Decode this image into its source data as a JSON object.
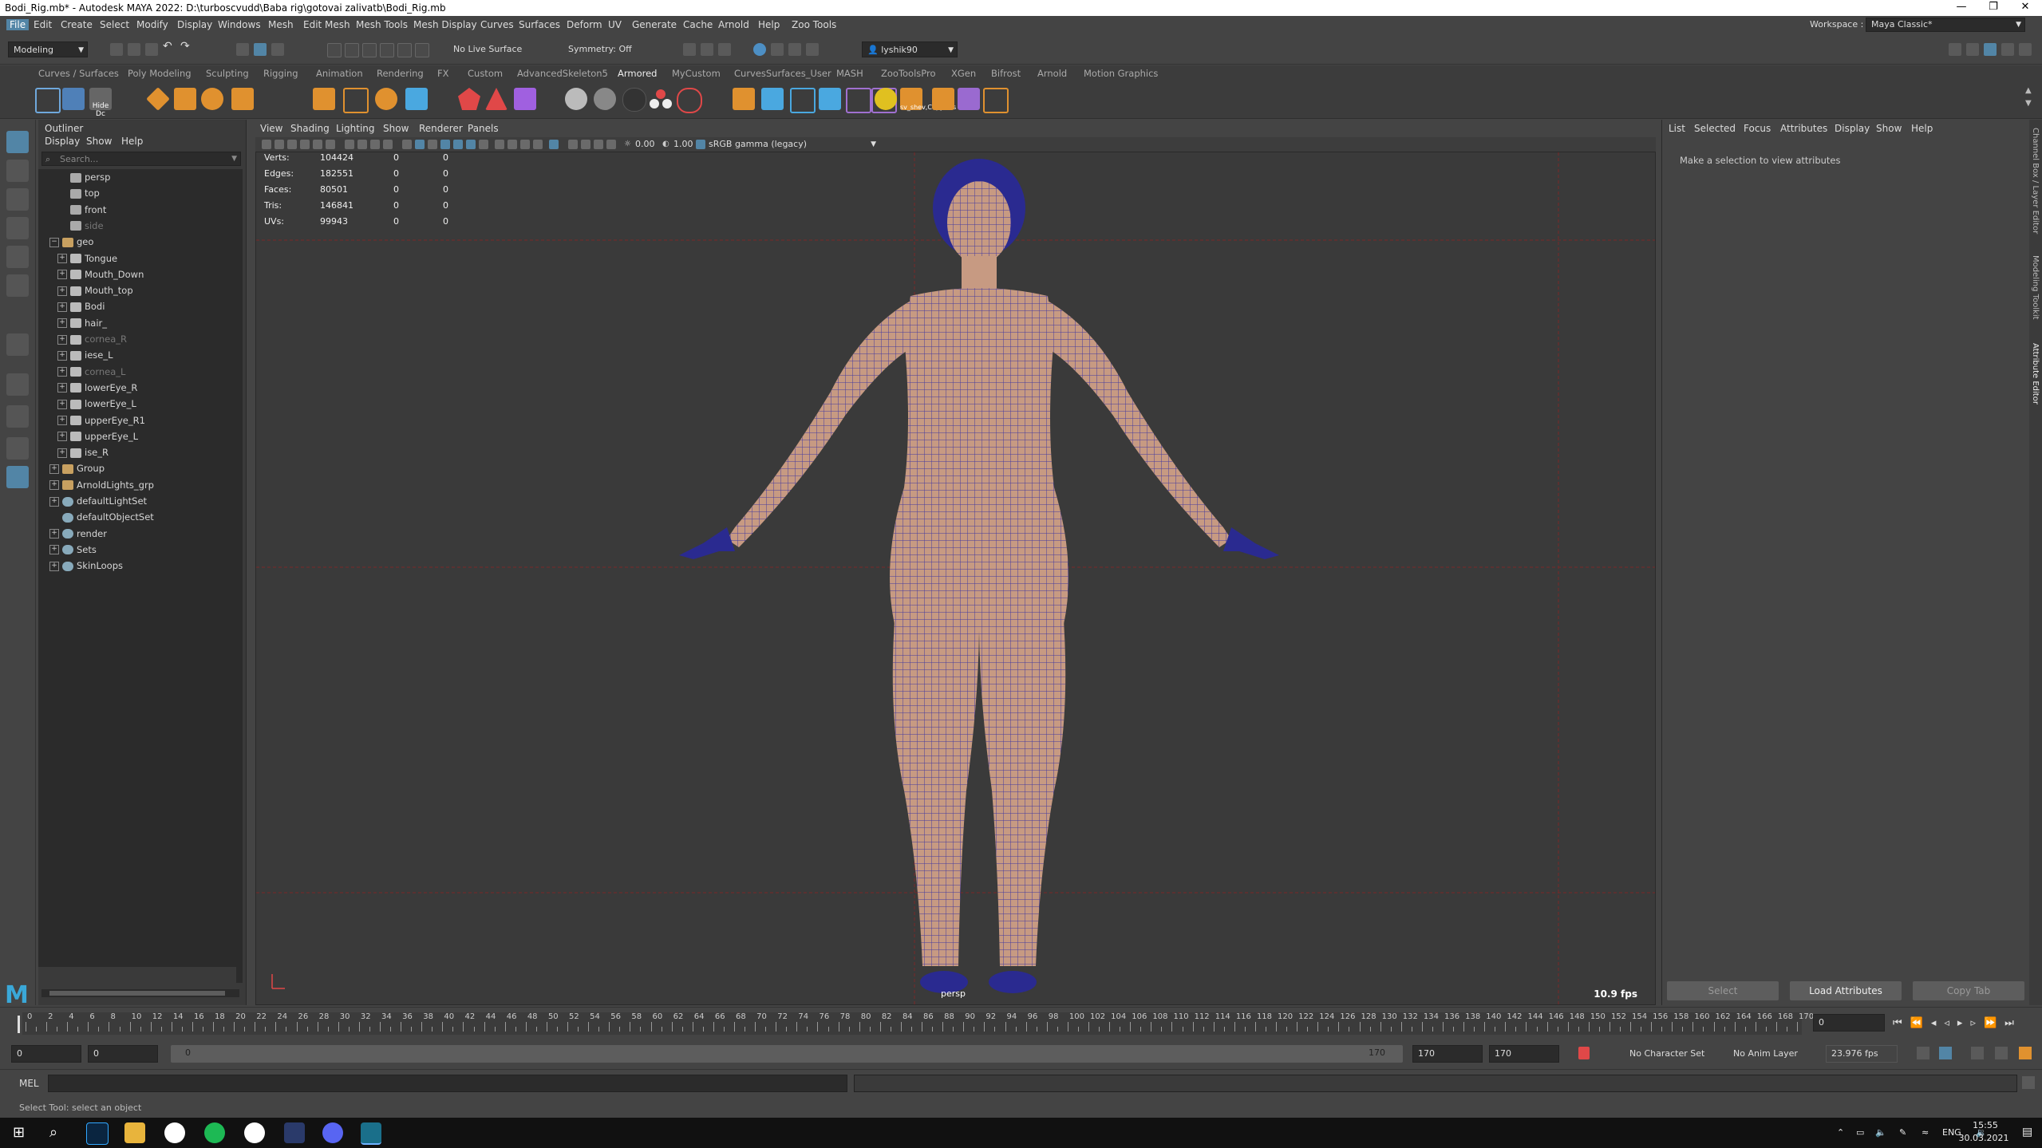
{
  "window": {
    "title": "Bodi_Rig.mb* - Autodesk MAYA 2022: D:\\turboscvudd\\Baba rig\\gotovai zalivatb\\Bodi_Rig.mb",
    "controls": [
      "—",
      "❐",
      "✕"
    ]
  },
  "menubar": {
    "items": [
      "File",
      "Edit",
      "Create",
      "Select",
      "Modify",
      "Display",
      "Windows",
      "Mesh",
      "Edit Mesh",
      "Mesh Tools",
      "Mesh Display",
      "Curves",
      "Surfaces",
      "Deform",
      "UV",
      "Generate",
      "Cache",
      "Arnold",
      "Help",
      "Zoo Tools"
    ],
    "workspace_label": "Workspace :",
    "workspace_value": "Maya Classic*"
  },
  "statusline": {
    "mode": "Modeling",
    "live_surface": "No Live Surface",
    "symmetry": "Symmetry: Off",
    "user": "lyshik90"
  },
  "shelf": {
    "tabs": [
      "Curves / Surfaces",
      "Poly Modeling",
      "Sculpting",
      "Rigging",
      "Animation",
      "Rendering",
      "FX",
      "Custom",
      "AdvancedSkeleton5",
      "Armored",
      "MyCustom",
      "CurvesSurfaces_User",
      "MASH",
      "ZooToolsPro",
      "XGen",
      "Bifrost",
      "Arnold",
      "Motion Graphics"
    ],
    "active_tab": "Armored",
    "hide_label": "Hide Dc",
    "copy_label": "sv_shev,CopyUVs"
  },
  "outliner": {
    "title": "Outliner",
    "menu": [
      "Display",
      "Show",
      "Help"
    ],
    "search_placeholder": "Search...",
    "items": [
      {
        "label": "persp",
        "indent": 2,
        "type": "camera",
        "dim": false,
        "expand": ""
      },
      {
        "label": "top",
        "indent": 2,
        "type": "camera",
        "dim": false,
        "expand": ""
      },
      {
        "label": "front",
        "indent": 2,
        "type": "camera",
        "dim": false,
        "expand": ""
      },
      {
        "label": "side",
        "indent": 2,
        "type": "camera",
        "dim": true,
        "expand": ""
      },
      {
        "label": "geo",
        "indent": 1,
        "type": "group",
        "dim": false,
        "expand": "−"
      },
      {
        "label": "Tongue",
        "indent": 2,
        "type": "mesh",
        "dim": false,
        "expand": "+"
      },
      {
        "label": "Mouth_Down",
        "indent": 2,
        "type": "mesh",
        "dim": false,
        "expand": "+"
      },
      {
        "label": "Mouth_top",
        "indent": 2,
        "type": "mesh",
        "dim": false,
        "expand": "+"
      },
      {
        "label": "Bodi",
        "indent": 2,
        "type": "mesh",
        "dim": false,
        "expand": "+"
      },
      {
        "label": "hair_",
        "indent": 2,
        "type": "mesh",
        "dim": false,
        "expand": "+"
      },
      {
        "label": "cornea_R",
        "indent": 2,
        "type": "mesh",
        "dim": true,
        "expand": "+"
      },
      {
        "label": "iese_L",
        "indent": 2,
        "type": "mesh",
        "dim": false,
        "expand": "+"
      },
      {
        "label": "cornea_L",
        "indent": 2,
        "type": "mesh",
        "dim": true,
        "expand": "+"
      },
      {
        "label": "lowerEye_R",
        "indent": 2,
        "type": "mesh",
        "dim": false,
        "expand": "+"
      },
      {
        "label": "lowerEye_L",
        "indent": 2,
        "type": "mesh",
        "dim": false,
        "expand": "+"
      },
      {
        "label": "upperEye_R1",
        "indent": 2,
        "type": "mesh",
        "dim": false,
        "expand": "+"
      },
      {
        "label": "upperEye_L",
        "indent": 2,
        "type": "mesh",
        "dim": false,
        "expand": "+"
      },
      {
        "label": "ise_R",
        "indent": 2,
        "type": "mesh",
        "dim": false,
        "expand": "+"
      },
      {
        "label": "Group",
        "indent": 1,
        "type": "group",
        "dim": false,
        "expand": "+"
      },
      {
        "label": "ArnoldLights_grp",
        "indent": 1,
        "type": "group",
        "dim": false,
        "expand": "+"
      },
      {
        "label": "defaultLightSet",
        "indent": 1,
        "type": "set",
        "dim": false,
        "expand": "+"
      },
      {
        "label": "defaultObjectSet",
        "indent": 1,
        "type": "set",
        "dim": false,
        "expand": ""
      },
      {
        "label": "render",
        "indent": 1,
        "type": "set",
        "dim": false,
        "expand": "+"
      },
      {
        "label": "Sets",
        "indent": 1,
        "type": "set",
        "dim": false,
        "expand": "+"
      },
      {
        "label": "SkinLoops",
        "indent": 1,
        "type": "set",
        "dim": false,
        "expand": "+"
      }
    ]
  },
  "viewport": {
    "menu": [
      "View",
      "Shading",
      "Lighting",
      "Show",
      "Renderer",
      "Panels"
    ],
    "exposure": "0.00",
    "gamma": "1.00",
    "color_space": "sRGB gamma (legacy)",
    "hud": [
      {
        "label": "Verts:",
        "a": "104424",
        "b": "0",
        "c": "0"
      },
      {
        "label": "Edges:",
        "a": "182551",
        "b": "0",
        "c": "0"
      },
      {
        "label": "Faces:",
        "a": "80501",
        "b": "0",
        "c": "0"
      },
      {
        "label": "Tris:",
        "a": "146841",
        "b": "0",
        "c": "0"
      },
      {
        "label": "UVs:",
        "a": "99943",
        "b": "0",
        "c": "0"
      }
    ],
    "fps": "10.9 fps",
    "camera": "persp",
    "skin_color": "#c79a82",
    "wire_color": "#1a1aa8"
  },
  "attribute_editor": {
    "menu": [
      "List",
      "Selected",
      "Focus",
      "Attributes",
      "Display",
      "Show",
      "Help"
    ],
    "message": "Make a selection to view attributes",
    "buttons": [
      "Select",
      "Load Attributes",
      "Copy Tab"
    ],
    "side_tabs": [
      "Channel Box / Layer Editor",
      "Modeling Toolkit",
      "Attribute Editor"
    ]
  },
  "timeline": {
    "start": 0,
    "end": 170,
    "current": "0",
    "current_field": "0"
  },
  "range": {
    "start": "0",
    "anim_start": "0",
    "range_min": "0",
    "range_max": "170",
    "anim_end": "170",
    "end": "170",
    "character_set": "No Character Set",
    "anim_layer": "No Anim Layer",
    "fps": "23.976 fps"
  },
  "command_line": {
    "label": "MEL"
  },
  "help_line": {
    "text": "Select Tool: select an object"
  },
  "taskbar": {
    "lang": "ENG",
    "time": "15:55",
    "date": "30.03.2021"
  }
}
